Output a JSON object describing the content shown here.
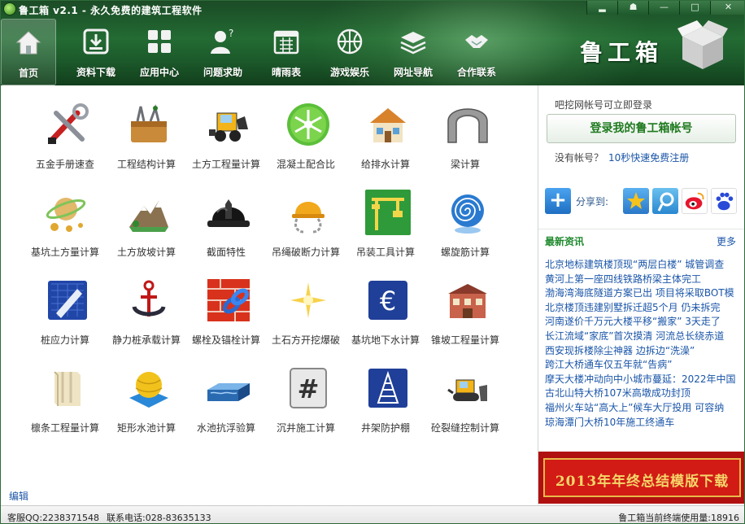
{
  "window": {
    "title": "鲁工箱 v2.1 - 永久免费的建筑工程软件",
    "controls": [
      "▂",
      "☗",
      "—",
      "□",
      "✕"
    ]
  },
  "toolbar": [
    {
      "label": "首页",
      "icon": "home-icon",
      "active": true
    },
    {
      "label": "资料下载",
      "icon": "download-icon"
    },
    {
      "label": "应用中心",
      "icon": "grid-icon"
    },
    {
      "label": "问题求助",
      "icon": "help-person-icon"
    },
    {
      "label": "晴雨表",
      "icon": "calendar-icon"
    },
    {
      "label": "游戏娱乐",
      "icon": "ball-icon"
    },
    {
      "label": "网址导航",
      "icon": "layers-icon"
    },
    {
      "label": "合作联系",
      "icon": "handshake-icon"
    }
  ],
  "brand": {
    "text": "鲁工箱"
  },
  "apps": [
    {
      "label": "五金手册速查",
      "icon": "tools-icon"
    },
    {
      "label": "工程结构计算",
      "icon": "toolbox-icon"
    },
    {
      "label": "土方工程量计算",
      "icon": "loader-icon"
    },
    {
      "label": "混凝土配合比",
      "icon": "snowflake-icon"
    },
    {
      "label": "给排水计算",
      "icon": "house-icon"
    },
    {
      "label": "梁计算",
      "icon": "arch-icon"
    },
    {
      "label": "基坑土方量计算",
      "icon": "planet-icon"
    },
    {
      "label": "土方放坡计算",
      "icon": "terrain-icon"
    },
    {
      "label": "截面特性",
      "icon": "hardhat-icon"
    },
    {
      "label": "吊绳破断力计算",
      "icon": "helmet-chain-icon"
    },
    {
      "label": "吊装工具计算",
      "icon": "crane-icon"
    },
    {
      "label": "螺旋筋计算",
      "icon": "spiral-icon"
    },
    {
      "label": "桩应力计算",
      "icon": "blueprint-icon"
    },
    {
      "label": "静力桩承载计算",
      "icon": "anchor-icon"
    },
    {
      "label": "螺栓及锚栓计算",
      "icon": "brick-chain-icon"
    },
    {
      "label": "土石方开挖爆破",
      "icon": "burst-icon"
    },
    {
      "label": "基坑地下水计算",
      "icon": "euro-icon"
    },
    {
      "label": "锥坡工程量计算",
      "icon": "building-icon"
    },
    {
      "label": "檩条工程量计算",
      "icon": "beam-icon"
    },
    {
      "label": "矩形水池计算",
      "icon": "ball-pool-icon"
    },
    {
      "label": "水池抗浮验算",
      "icon": "pool-icon"
    },
    {
      "label": "沉井施工计算",
      "icon": "hash-icon"
    },
    {
      "label": "井架防护棚",
      "icon": "tower-icon"
    },
    {
      "label": "砼裂缝控制计算",
      "icon": "bulldozer-icon"
    }
  ],
  "edit_link": "编辑",
  "side": {
    "login_hint": "吧挖网帐号可立即登录",
    "login_button": "登录我的鲁工箱帐号",
    "no_account": "没有帐号？",
    "register_link": "10秒快速免费注册",
    "share_label": "分享到:",
    "news_title": "最新资讯",
    "news_more": "更多",
    "news": [
      "北京地标建筑楼顶现“两层白楼” 城管调查",
      "黄河上第一座四线铁路桥梁主体完工",
      "渤海湾海底隧道方案已出 项目将采取BOT模",
      "北京楼顶违建别墅拆迁超5个月 仍未拆完",
      "河南遂价千万元大楼平移“搬家” 3天走了",
      "长江流域“家底”首次摸清 河流总长绕赤道",
      "西安现拆楼除尘神器 边拆边“洗澡”",
      "跨江大桥通车仅五年就“告病”",
      "摩天大楼冲动向中小城市蔓延：2022年中国",
      "古北山特大桥107米高墩成功封顶",
      "福州火车站“高大上”候车大厅投用 可容纳",
      "琼海潭门大桥10年施工终通车"
    ],
    "banner": "2013年年终总结模版下载"
  },
  "status": {
    "qq": "客服QQ:2238371548",
    "phone": "联系电话:028-83635133",
    "users": "鲁工箱当前终端使用量:18916"
  },
  "colors": {
    "header": "#236b33",
    "link": "#1a55a8",
    "news_title": "#1f8a2e",
    "banner": "#d21b15"
  }
}
